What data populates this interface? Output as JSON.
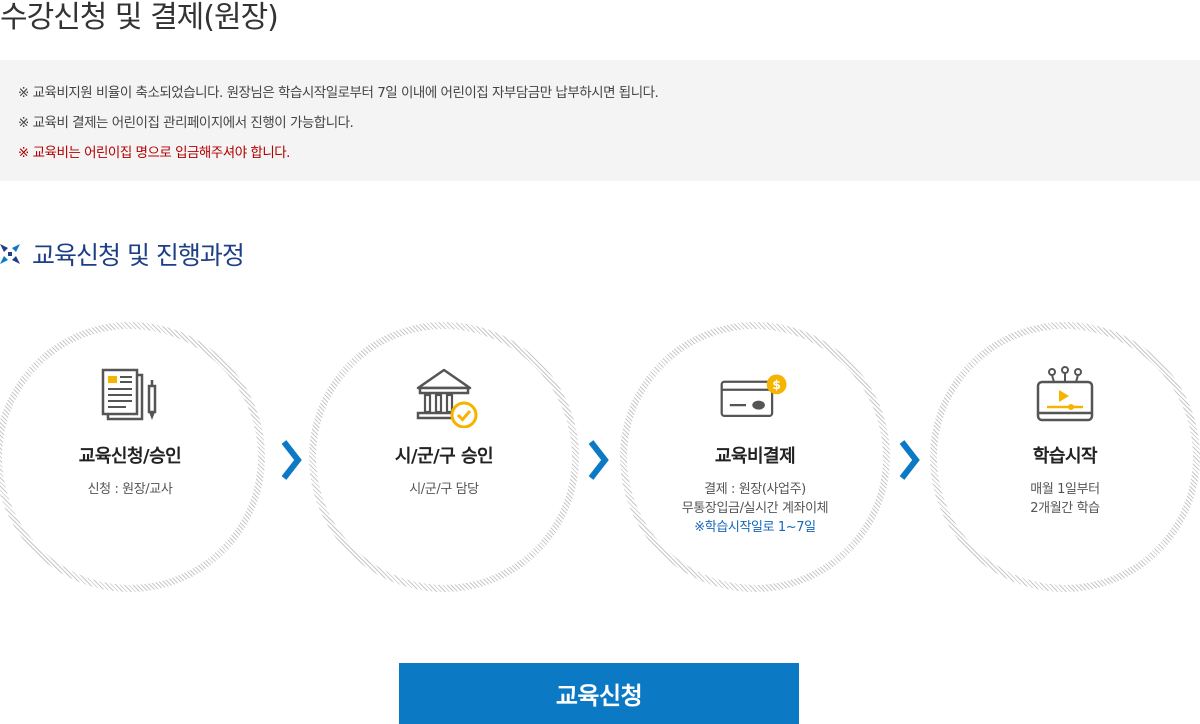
{
  "page_title": "수강신청 및 결제(원장)",
  "notice": {
    "lines": [
      "※ 교육비지원 비율이 축소되었습니다. 원장님은 학습시작일로부터 7일 이내에 어린이집 자부담금만 납부하시면 됩니다.",
      "※ 교육비 결제는 어린이집 관리페이지에서 진행이 가능합니다.",
      "※ 교육비는 어린이집 명으로 입금해주셔야 합니다."
    ]
  },
  "section": {
    "title": "교육신청 및 진행과정",
    "icon": "cross-arrows-icon"
  },
  "steps": [
    {
      "title": "교육신청/승인",
      "icon": "document-pen-icon",
      "desc": [
        "신청 : 원장/교사"
      ]
    },
    {
      "title": "시/군/구 승인",
      "icon": "bank-check-icon",
      "desc": [
        "시/군/구 담당"
      ]
    },
    {
      "title": "교육비결제",
      "icon": "card-coin-icon",
      "desc": [
        "결제 : 원장(사업주)",
        "무통장입금/실시간 계좌이체"
      ],
      "highlight": "※학습시작일로 1~7일"
    },
    {
      "title": "학습시작",
      "icon": "video-monitor-icon",
      "desc": [
        "매월 1일부터",
        "2개월간 학습"
      ]
    }
  ],
  "apply_button": {
    "label": "교육신청"
  },
  "colors": {
    "accent_blue": "#0b79c4",
    "title_navy": "#1d3f86",
    "notice_red": "#b30000",
    "icon_yellow": "#f5b400"
  }
}
